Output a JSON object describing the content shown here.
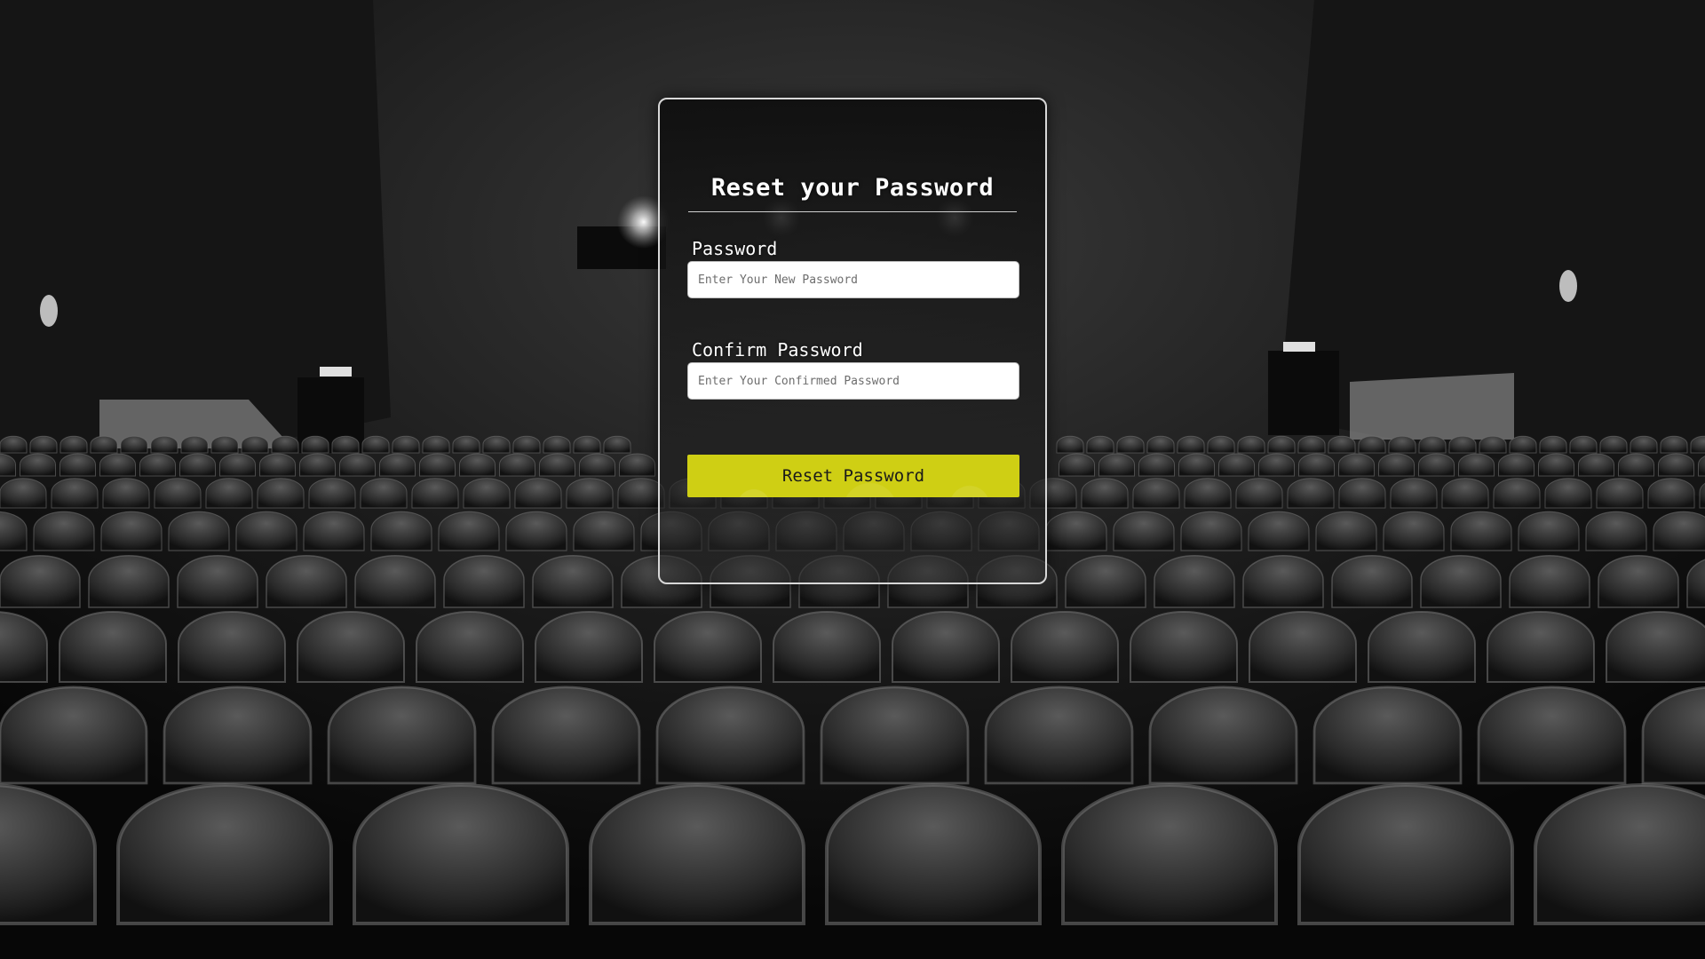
{
  "form": {
    "title": "Reset your Password",
    "password_label": "Password",
    "password_placeholder": "Enter Your New Password",
    "confirm_label": "Confirm Password",
    "confirm_placeholder": "Enter Your Confirmed Password",
    "submit_label": "Reset Password"
  },
  "colors": {
    "button_bg": "#cfcf14",
    "card_border": "#d8d8d8",
    "background": "#0c0c0c"
  }
}
